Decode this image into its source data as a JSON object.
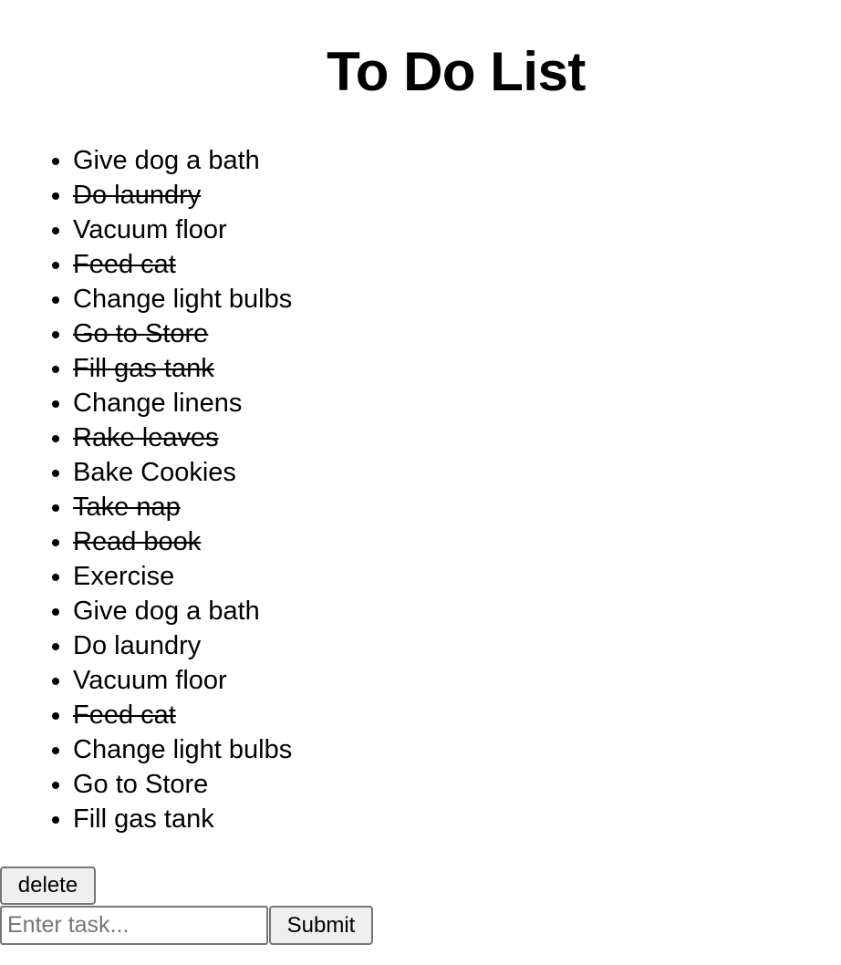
{
  "header": {
    "title": "To Do List"
  },
  "tasks": [
    {
      "label": "Give dog a bath",
      "done": false
    },
    {
      "label": "Do laundry",
      "done": true
    },
    {
      "label": "Vacuum floor",
      "done": false
    },
    {
      "label": "Feed cat",
      "done": true
    },
    {
      "label": "Change light bulbs",
      "done": false
    },
    {
      "label": "Go to Store",
      "done": true
    },
    {
      "label": "Fill gas tank",
      "done": true
    },
    {
      "label": "Change linens",
      "done": false
    },
    {
      "label": "Rake leaves",
      "done": true
    },
    {
      "label": "Bake Cookies",
      "done": false
    },
    {
      "label": "Take nap",
      "done": true
    },
    {
      "label": "Read book",
      "done": true
    },
    {
      "label": "Exercise",
      "done": false
    },
    {
      "label": "Give dog a bath",
      "done": false
    },
    {
      "label": "Do laundry",
      "done": false
    },
    {
      "label": "Vacuum floor",
      "done": false
    },
    {
      "label": "Feed cat",
      "done": true
    },
    {
      "label": "Change light bulbs",
      "done": false
    },
    {
      "label": "Go to Store",
      "done": false
    },
    {
      "label": "Fill gas tank",
      "done": false
    }
  ],
  "controls": {
    "delete_label": "delete",
    "input_value": "",
    "input_placeholder": "Enter task...",
    "submit_label": "Submit"
  }
}
